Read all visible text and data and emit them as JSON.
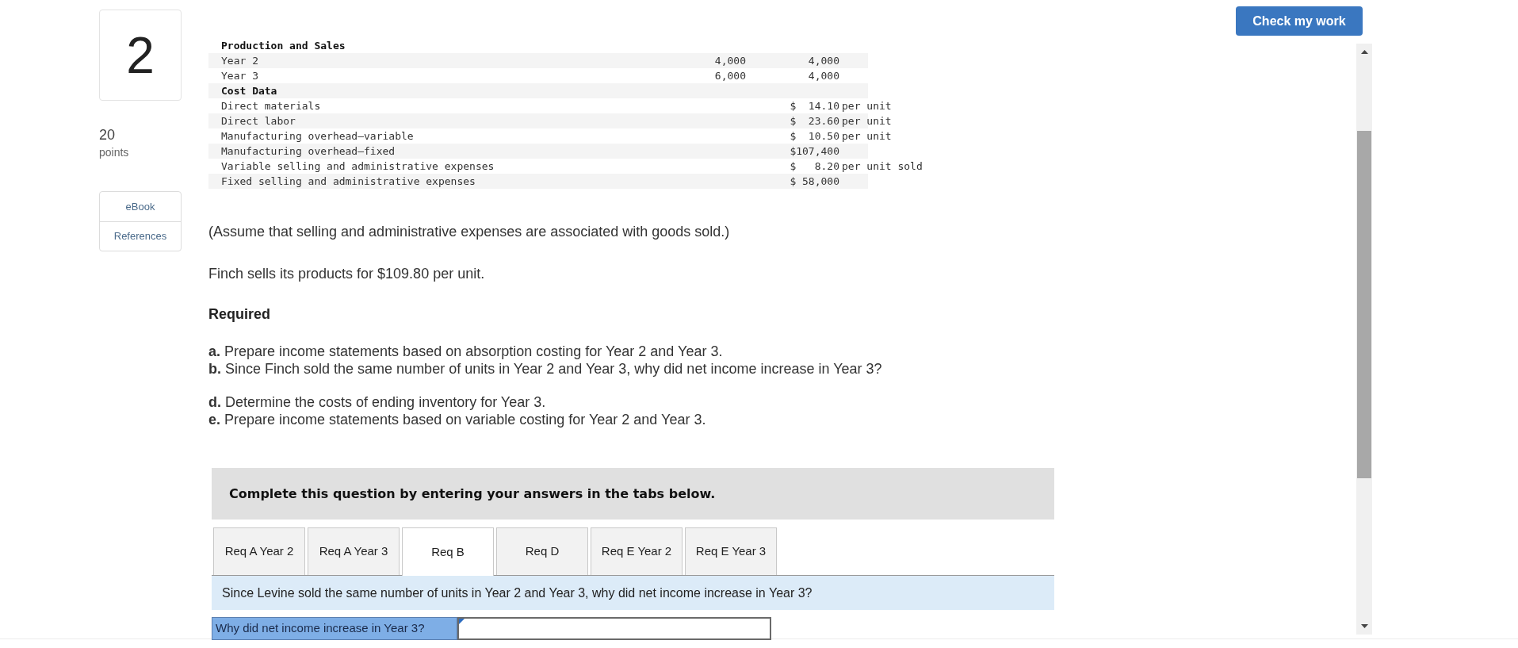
{
  "question": {
    "number": "2",
    "points": "20",
    "points_label": "points"
  },
  "resources": [
    {
      "label": "eBook"
    },
    {
      "label": "References"
    }
  ],
  "check_button": "Check my work",
  "data_table": {
    "rows": [
      {
        "kind": "heading",
        "label": "Production and Sales"
      },
      {
        "kind": "item",
        "label": "Year 2",
        "column_2": "4,000",
        "column_3": "4,000"
      },
      {
        "kind": "item",
        "label": "Year 3",
        "column_2": "6,000",
        "column_3": "4,000"
      },
      {
        "kind": "heading",
        "label": "Cost Data"
      },
      {
        "kind": "item",
        "label": "Direct materials",
        "column_3": "$  14.10",
        "unit": "per unit"
      },
      {
        "kind": "item",
        "label": "Direct labor",
        "column_3": "$  23.60",
        "unit": "per unit"
      },
      {
        "kind": "item",
        "label": "Manufacturing overhead—variable",
        "column_3": "$  10.50",
        "unit": "per unit"
      },
      {
        "kind": "item",
        "label": "Manufacturing overhead—fixed",
        "column_3": "$107,400"
      },
      {
        "kind": "item",
        "label": "Variable selling and administrative expenses",
        "column_3": "$   8.20",
        "unit": "per unit sold"
      },
      {
        "kind": "item",
        "label": "Fixed selling and administrative expenses",
        "column_3": "$ 58,000"
      }
    ]
  },
  "paragraphs": [
    "(Assume that selling and administrative expenses are associated with goods sold.)",
    "Finch sells its products for $109.80 per unit."
  ],
  "required_heading": "Required",
  "requirements": [
    [
      "**a.** Prepare income statements based on absorption costing for Year 2 and Year 3.",
      "**b.** Since Finch sold the same number of units in Year 2 and Year 3, why did net income increase in Year 3?"
    ],
    [
      "**d.** Determine the costs of ending inventory for Year 3.",
      "**e.** Prepare income statements based on variable costing for Year 2 and Year 3."
    ]
  ],
  "instruction": "Complete this question by entering your answers in the tabs below.",
  "tabs": [
    {
      "label": "Req A Year 2",
      "selected": false
    },
    {
      "label": "Req A Year 3",
      "selected": false
    },
    {
      "label": "Req B",
      "selected": true
    },
    {
      "label": "Req D",
      "selected": false
    },
    {
      "label": "Req E Year 2",
      "selected": false
    },
    {
      "label": "Req E Year 3",
      "selected": false
    }
  ],
  "tab_prompt": "Since Levine sold the same number of units in Year 2 and Year 3, why did net income increase in Year 3?",
  "answer_row": {
    "label": "Why did net income increase in Year 3?"
  }
}
